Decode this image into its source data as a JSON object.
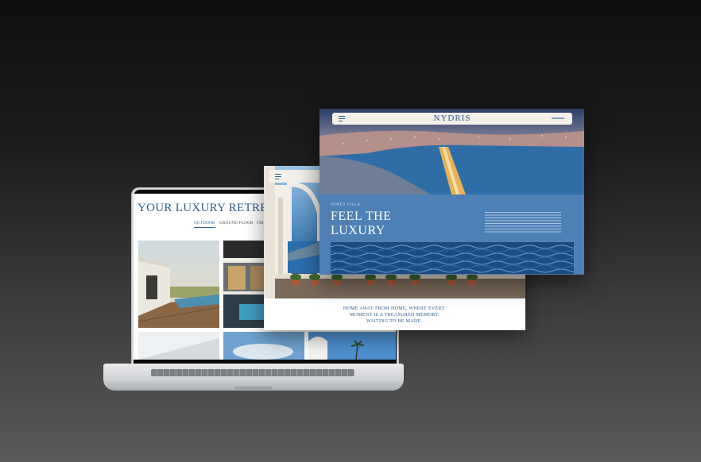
{
  "laptop": {
    "title": "YOUR LUXURY RETREAT",
    "tabs": [
      {
        "label": "OUTDOOR",
        "active": true
      },
      {
        "label": "GROUND FLOOR",
        "active": false
      },
      {
        "label": "FIR",
        "active": false
      }
    ]
  },
  "middle_page": {
    "caption": "HOME AWAY FROM HOME, WHERE EVERY MOMENT IS A TREASURED MEMORY WAITING TO BE MADE."
  },
  "front_page": {
    "brand": "NYDRIS",
    "tag": "PORTO VILLA",
    "headline_line1": "FEEL THE",
    "headline_line2": "LUXURY"
  },
  "colors": {
    "accent": "#2f5d8c",
    "panel_blue": "#4e80b6"
  },
  "icons": [
    "menu-icon"
  ]
}
